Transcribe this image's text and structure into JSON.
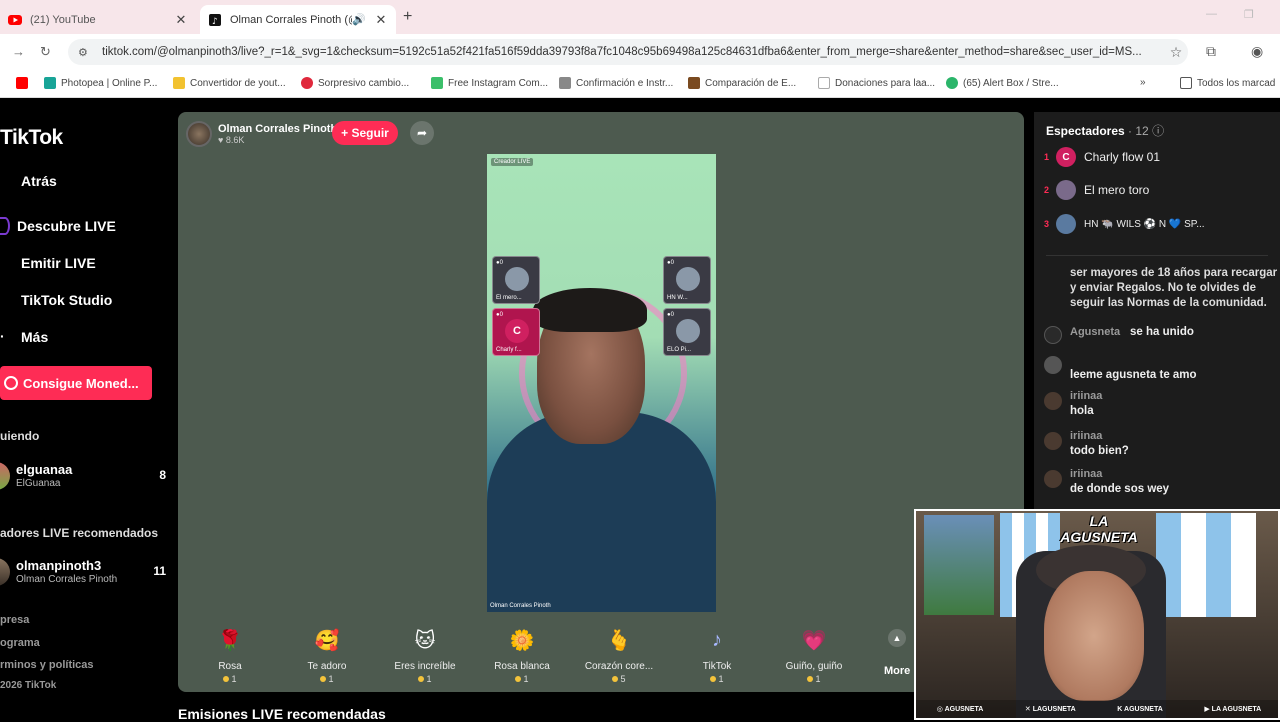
{
  "browser": {
    "tabs": [
      {
        "title": "(21) YouTube",
        "active": false
      },
      {
        "title": "Olman Corrales Pinoth (@o",
        "active": true
      }
    ],
    "url": "tiktok.com/@olmanpinoth3/live?_r=1&_svg=1&checksum=5192c51a52f421fa516f59dda39793f8a7fc1048c95b69498a125c84631dfba6&enter_from_merge=share&enter_method=share&sec_user_id=MS...",
    "bookmarks": [
      "Photopea | Online P...",
      "Convertidor de yout...",
      "Sorpresivo cambio...",
      "Free Instagram Com...",
      "Confirmación e Instr...",
      "Comparación de E...",
      "Donaciones para laa...",
      "(65) Alert Box / Stre...",
      "Todos los marcad"
    ]
  },
  "sidebar": {
    "logo": "TikTok",
    "nav": [
      {
        "label": "Atrás"
      },
      {
        "label": "Descubre LIVE"
      },
      {
        "label": "Emitir LIVE"
      },
      {
        "label": "TikTok Studio"
      },
      {
        "label": "Más"
      }
    ],
    "coins_button": "Consigue Moned...",
    "following_title": "uiendo",
    "following": [
      {
        "username": "elguanaa",
        "display": "ElGuanaa",
        "count": "8"
      }
    ],
    "recommended_title": "adores LIVE recomendados",
    "recommended": [
      {
        "username": "olmanpinoth3",
        "display": "Olman Corrales Pinoth",
        "count": "11"
      }
    ],
    "footer": [
      "presa",
      "ograma",
      "rminos y políticas",
      "2026 TikTok"
    ]
  },
  "live": {
    "host_name": "Olman Corrales Pinoth",
    "host_likes": "8.6K",
    "follow_label": "+ Seguir",
    "video_tag": "Creador LIVE",
    "video_watermark": "Olman Corrales Pinoth",
    "guests": [
      {
        "name": "El mero..."
      },
      {
        "name": "HN W..."
      },
      {
        "name": "Charly f...",
        "initial": "C"
      },
      {
        "name": "ELO Pi..."
      }
    ],
    "gifts": [
      {
        "name": "Rosa",
        "price": "1",
        "icon": "rose-icon",
        "glyph": "🌹"
      },
      {
        "name": "Te adoro",
        "price": "1",
        "icon": "heart-face-icon",
        "glyph": "🥰"
      },
      {
        "name": "Eres increíble",
        "price": "1",
        "icon": "cat-icon",
        "glyph": "🐱"
      },
      {
        "name": "Rosa blanca",
        "price": "1",
        "icon": "white-rose-icon",
        "glyph": "🌼"
      },
      {
        "name": "Corazón core...",
        "price": "5",
        "icon": "finger-heart-icon",
        "glyph": "🫰"
      },
      {
        "name": "TikTok",
        "price": "1",
        "icon": "tiktok-icon",
        "glyph": "♪"
      },
      {
        "name": "Guiño, guiño",
        "price": "1",
        "icon": "wink-heart-icon",
        "glyph": "💗"
      }
    ],
    "more_label": "More",
    "recommended_streams_title": "Emisiones LIVE recomendadas"
  },
  "chat": {
    "viewers_label": "Espectadores",
    "viewers_count": "· 12",
    "top_viewers": [
      {
        "rank": "1",
        "name": "Charly flow 01",
        "initial": "C",
        "color": "#d02060"
      },
      {
        "rank": "2",
        "name": "El mero toro",
        "initial": "",
        "color": "#7a6a8a"
      },
      {
        "rank": "3",
        "name": "HN 🐃 WILS ⚽ N 💙 SP...",
        "initial": "",
        "color": "#5a7aa0"
      }
    ],
    "system_message": "ser mayores de 18 años para recargar y enviar Regalos. No te olvides de seguir las Normas de la comunidad.",
    "join_user": "Agusneta",
    "join_text": "se ha unido",
    "messages": [
      {
        "user": "",
        "text": "leeme agusneta te amo"
      },
      {
        "user": "iriinaa",
        "text": "hola"
      },
      {
        "user": "iriinaa",
        "text": "todo bien?"
      },
      {
        "user": "iriinaa",
        "text": "de donde sos wey"
      }
    ]
  },
  "webcam": {
    "logo": "LA AGUSNETA",
    "socials": [
      "AGUSNETA",
      "LAGUSNETA",
      "AGUSNETA",
      "LA AGUSNETA"
    ]
  }
}
